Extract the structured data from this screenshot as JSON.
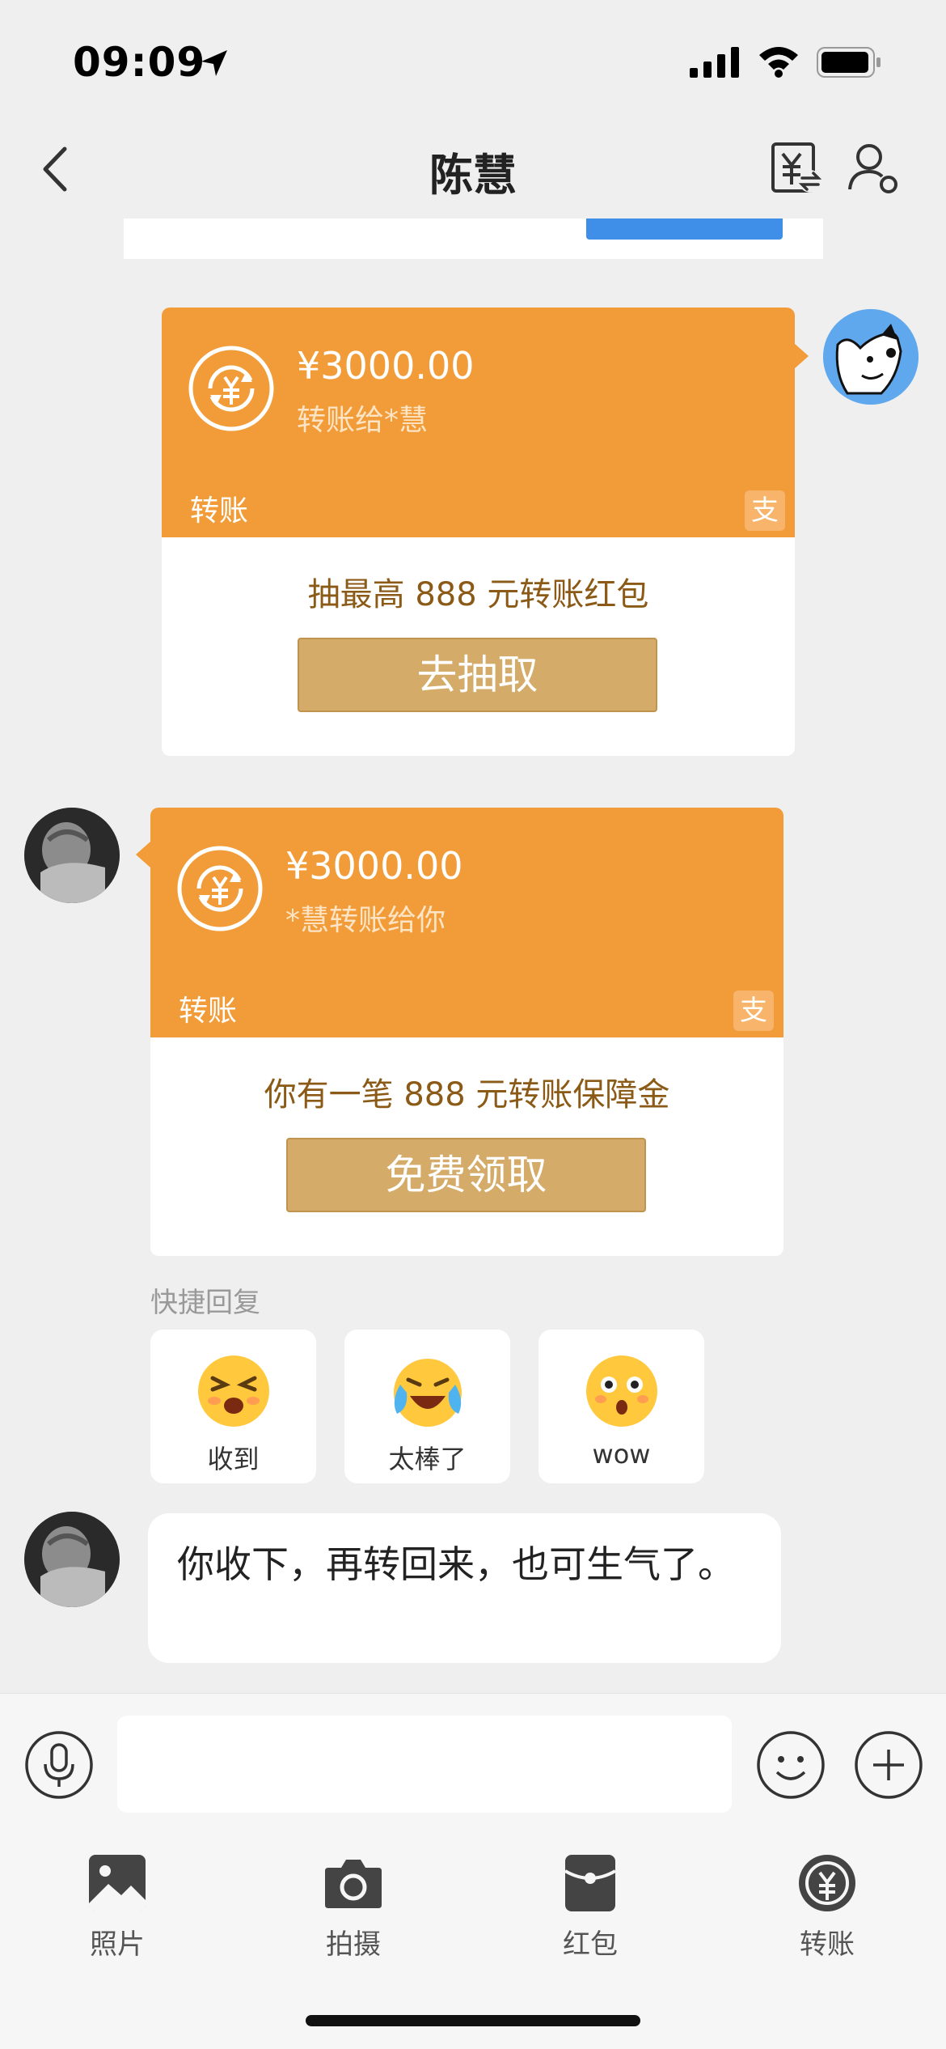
{
  "status_bar": {
    "time": "09:09"
  },
  "nav": {
    "title": "陈慧"
  },
  "messages": {
    "sent_transfer": {
      "amount": "¥3000.00",
      "subtitle": "转账给*慧",
      "label": "转账",
      "badge": "支",
      "promo": "抽最高 888 元转账红包",
      "button": "去抽取"
    },
    "received_transfer": {
      "amount": "¥3000.00",
      "subtitle": "*慧转账给你",
      "label": "转账",
      "badge": "支",
      "promo": "你有一笔 888 元转账保障金",
      "button": "免费领取"
    },
    "quick_reply": {
      "title": "快捷回复",
      "items": [
        {
          "label": "收到",
          "icon": "grimace-emoji-icon"
        },
        {
          "label": "太棒了",
          "icon": "crying-laughing-emoji-icon"
        },
        {
          "label": "wow",
          "icon": "surprised-emoji-icon"
        }
      ]
    },
    "text_message": "你收下，再转回来，也可生气了。"
  },
  "toolbar": {
    "items": [
      {
        "label": "照片",
        "icon": "photo-icon"
      },
      {
        "label": "拍摄",
        "icon": "camera-icon"
      },
      {
        "label": "红包",
        "icon": "red-packet-icon"
      },
      {
        "label": "转账",
        "icon": "transfer-icon"
      }
    ]
  },
  "colors": {
    "transfer_orange": "#f19c38",
    "action_gold": "#d4ab68",
    "promo_brown": "#8a5a16",
    "background": "#efefef"
  }
}
